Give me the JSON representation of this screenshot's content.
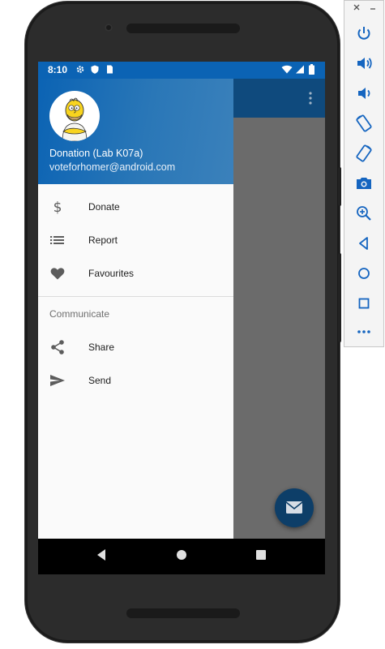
{
  "status_bar": {
    "time": "8:10",
    "icons": [
      "settings-icon",
      "shield-icon",
      "sim-card-icon",
      "wifi-icon",
      "cell-signal-icon",
      "battery-icon"
    ]
  },
  "app_bar": {
    "color": "#0f4a7d",
    "overflow_icon": "more-vert-icon"
  },
  "drawer": {
    "header": {
      "name": "Donation (Lab K07a)",
      "email": "voteforhomer@android.com",
      "avatar": "homer-avatar"
    },
    "items": [
      {
        "icon": "dollar-icon",
        "label": "Donate"
      },
      {
        "icon": "list-icon",
        "label": "Report"
      },
      {
        "icon": "heart-icon",
        "label": "Favourites"
      }
    ],
    "section_title": "Communicate",
    "section_items": [
      {
        "icon": "share-icon",
        "label": "Share"
      },
      {
        "icon": "send-icon",
        "label": "Send"
      }
    ]
  },
  "fab": {
    "icon": "mail-icon",
    "color": "#0d3e68"
  },
  "nav_bar": {
    "icons": [
      "back-icon",
      "home-icon",
      "recents-icon"
    ]
  },
  "emulator_panel": {
    "window_controls": [
      "close-icon",
      "minimize-icon"
    ],
    "buttons": [
      "power-icon",
      "volume-up-icon",
      "volume-down-icon",
      "rotate-left-icon",
      "rotate-right-icon",
      "camera-icon",
      "zoom-in-icon",
      "back-icon",
      "home-icon",
      "overview-icon",
      "more-icon"
    ]
  },
  "colors": {
    "primary": "#0b63b4",
    "primary_dark": "#0f4a7d",
    "drawer_bg": "#fafafa",
    "scrim": "#6b6b6b"
  }
}
